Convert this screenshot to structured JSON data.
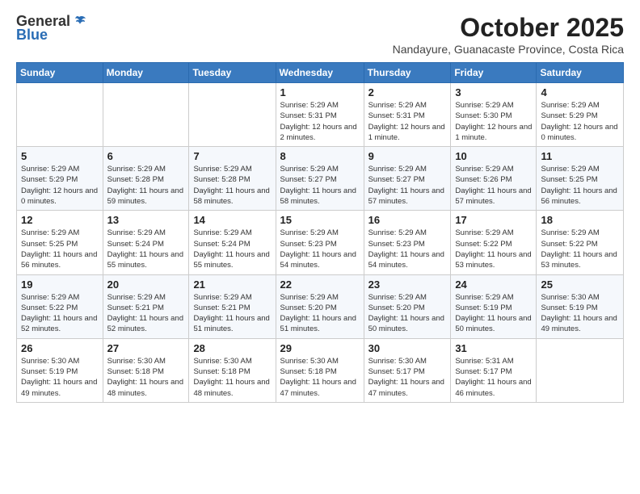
{
  "logo": {
    "general": "General",
    "blue": "Blue"
  },
  "header": {
    "month": "October 2025",
    "location": "Nandayure, Guanacaste Province, Costa Rica"
  },
  "weekdays": [
    "Sunday",
    "Monday",
    "Tuesday",
    "Wednesday",
    "Thursday",
    "Friday",
    "Saturday"
  ],
  "weeks": [
    [
      {
        "day": "",
        "info": ""
      },
      {
        "day": "",
        "info": ""
      },
      {
        "day": "",
        "info": ""
      },
      {
        "day": "1",
        "info": "Sunrise: 5:29 AM\nSunset: 5:31 PM\nDaylight: 12 hours\nand 2 minutes."
      },
      {
        "day": "2",
        "info": "Sunrise: 5:29 AM\nSunset: 5:31 PM\nDaylight: 12 hours\nand 1 minute."
      },
      {
        "day": "3",
        "info": "Sunrise: 5:29 AM\nSunset: 5:30 PM\nDaylight: 12 hours\nand 1 minute."
      },
      {
        "day": "4",
        "info": "Sunrise: 5:29 AM\nSunset: 5:29 PM\nDaylight: 12 hours\nand 0 minutes."
      }
    ],
    [
      {
        "day": "5",
        "info": "Sunrise: 5:29 AM\nSunset: 5:29 PM\nDaylight: 12 hours\nand 0 minutes."
      },
      {
        "day": "6",
        "info": "Sunrise: 5:29 AM\nSunset: 5:28 PM\nDaylight: 11 hours\nand 59 minutes."
      },
      {
        "day": "7",
        "info": "Sunrise: 5:29 AM\nSunset: 5:28 PM\nDaylight: 11 hours\nand 58 minutes."
      },
      {
        "day": "8",
        "info": "Sunrise: 5:29 AM\nSunset: 5:27 PM\nDaylight: 11 hours\nand 58 minutes."
      },
      {
        "day": "9",
        "info": "Sunrise: 5:29 AM\nSunset: 5:27 PM\nDaylight: 11 hours\nand 57 minutes."
      },
      {
        "day": "10",
        "info": "Sunrise: 5:29 AM\nSunset: 5:26 PM\nDaylight: 11 hours\nand 57 minutes."
      },
      {
        "day": "11",
        "info": "Sunrise: 5:29 AM\nSunset: 5:25 PM\nDaylight: 11 hours\nand 56 minutes."
      }
    ],
    [
      {
        "day": "12",
        "info": "Sunrise: 5:29 AM\nSunset: 5:25 PM\nDaylight: 11 hours\nand 56 minutes."
      },
      {
        "day": "13",
        "info": "Sunrise: 5:29 AM\nSunset: 5:24 PM\nDaylight: 11 hours\nand 55 minutes."
      },
      {
        "day": "14",
        "info": "Sunrise: 5:29 AM\nSunset: 5:24 PM\nDaylight: 11 hours\nand 55 minutes."
      },
      {
        "day": "15",
        "info": "Sunrise: 5:29 AM\nSunset: 5:23 PM\nDaylight: 11 hours\nand 54 minutes."
      },
      {
        "day": "16",
        "info": "Sunrise: 5:29 AM\nSunset: 5:23 PM\nDaylight: 11 hours\nand 54 minutes."
      },
      {
        "day": "17",
        "info": "Sunrise: 5:29 AM\nSunset: 5:22 PM\nDaylight: 11 hours\nand 53 minutes."
      },
      {
        "day": "18",
        "info": "Sunrise: 5:29 AM\nSunset: 5:22 PM\nDaylight: 11 hours\nand 53 minutes."
      }
    ],
    [
      {
        "day": "19",
        "info": "Sunrise: 5:29 AM\nSunset: 5:22 PM\nDaylight: 11 hours\nand 52 minutes."
      },
      {
        "day": "20",
        "info": "Sunrise: 5:29 AM\nSunset: 5:21 PM\nDaylight: 11 hours\nand 52 minutes."
      },
      {
        "day": "21",
        "info": "Sunrise: 5:29 AM\nSunset: 5:21 PM\nDaylight: 11 hours\nand 51 minutes."
      },
      {
        "day": "22",
        "info": "Sunrise: 5:29 AM\nSunset: 5:20 PM\nDaylight: 11 hours\nand 51 minutes."
      },
      {
        "day": "23",
        "info": "Sunrise: 5:29 AM\nSunset: 5:20 PM\nDaylight: 11 hours\nand 50 minutes."
      },
      {
        "day": "24",
        "info": "Sunrise: 5:29 AM\nSunset: 5:19 PM\nDaylight: 11 hours\nand 50 minutes."
      },
      {
        "day": "25",
        "info": "Sunrise: 5:30 AM\nSunset: 5:19 PM\nDaylight: 11 hours\nand 49 minutes."
      }
    ],
    [
      {
        "day": "26",
        "info": "Sunrise: 5:30 AM\nSunset: 5:19 PM\nDaylight: 11 hours\nand 49 minutes."
      },
      {
        "day": "27",
        "info": "Sunrise: 5:30 AM\nSunset: 5:18 PM\nDaylight: 11 hours\nand 48 minutes."
      },
      {
        "day": "28",
        "info": "Sunrise: 5:30 AM\nSunset: 5:18 PM\nDaylight: 11 hours\nand 48 minutes."
      },
      {
        "day": "29",
        "info": "Sunrise: 5:30 AM\nSunset: 5:18 PM\nDaylight: 11 hours\nand 47 minutes."
      },
      {
        "day": "30",
        "info": "Sunrise: 5:30 AM\nSunset: 5:17 PM\nDaylight: 11 hours\nand 47 minutes."
      },
      {
        "day": "31",
        "info": "Sunrise: 5:31 AM\nSunset: 5:17 PM\nDaylight: 11 hours\nand 46 minutes."
      },
      {
        "day": "",
        "info": ""
      }
    ]
  ]
}
